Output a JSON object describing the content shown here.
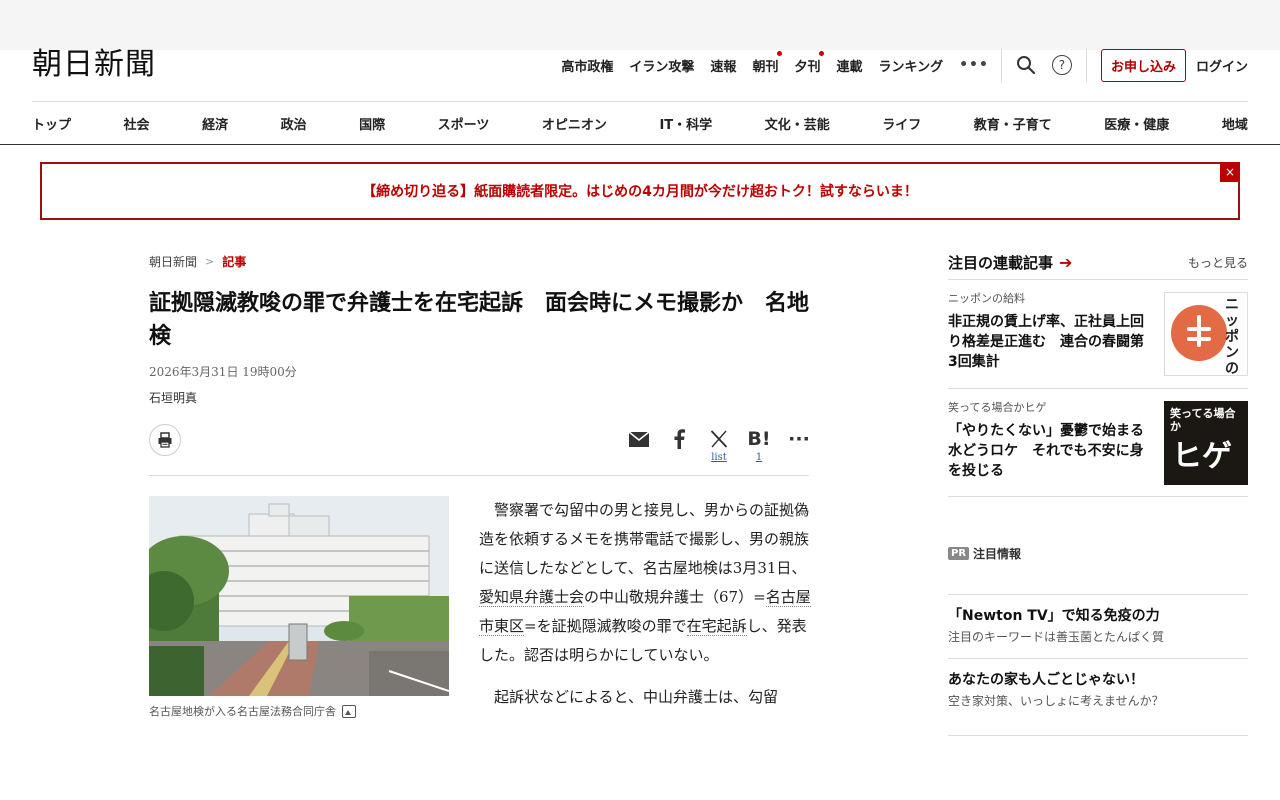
{
  "header": {
    "logo": "朝日新聞",
    "top_links": [
      {
        "label": "高市政権",
        "dot": false
      },
      {
        "label": "イラン攻撃",
        "dot": false
      },
      {
        "label": "速報",
        "dot": false
      },
      {
        "label": "朝刊",
        "dot": true
      },
      {
        "label": "夕刊",
        "dot": true
      },
      {
        "label": "連載",
        "dot": false
      },
      {
        "label": "ランキング",
        "dot": false
      }
    ],
    "more": "•••",
    "help": "?",
    "subscribe": "お申し込み",
    "login": "ログイン"
  },
  "nav": [
    "トップ",
    "社会",
    "経済",
    "政治",
    "国際",
    "スポーツ",
    "オピニオン",
    "IT・科学",
    "文化・芸能",
    "ライフ",
    "教育・子育て",
    "医療・健康",
    "地域"
  ],
  "banner": {
    "text": "【締め切り迫る】紙面購読者限定。はじめの4カ月間が今だけ超おトク！試すならいま！",
    "close": "×"
  },
  "article": {
    "breadcrumb_home": "朝日新聞",
    "breadcrumb_sep": ">",
    "breadcrumb_current": "記事",
    "title": "証拠隠滅教唆の罪で弁護士を在宅起訴　面会時にメモ撮影か　名地検",
    "date": "2026年3月31日 19時00分",
    "author": "石垣明真",
    "share": {
      "x_sub": "list",
      "hatena_label": "B!",
      "hatena_count": "1",
      "more": "···"
    },
    "photo_caption": "名古屋地検が入る名古屋法務合同庁舎",
    "p1_a": "警察署で勾留中の男と接見し、男からの証拠偽造を依頼するメモを携帯電話で撮影し、男の親族に送信したなどとして、名古屋地検は3月31日、",
    "p1_kw1": "愛知県弁護士会",
    "p1_b": "の中山敬規弁護士（67）=",
    "p1_kw2": "名古屋市東区",
    "p1_c": "=を証拠隠滅教唆の罪で",
    "p1_kw3": "在宅起訴",
    "p1_d": "し、発表した。認否は明らかにしていない。",
    "p2": "起訴状などによると、中山弁護士は、勾留"
  },
  "sidebar": {
    "title": "注目の連載記事",
    "more": "もっと見る",
    "series": [
      {
        "category": "ニッポンの給料",
        "title": "非正規の賃上げ率、正社員上回り格差是正進む　連合の春闘第3回集計",
        "thumb_text": "ニッポンの給料"
      },
      {
        "category": "笑ってる場合かヒゲ",
        "title": "「やりたくない」憂鬱で始まる水どうロケ　それでも不安に身を投じる",
        "thumb_text_small": "笑ってる場合か",
        "thumb_text_big": "ヒゲ"
      }
    ],
    "pr_badge": "PR",
    "pr_title": "注目情報",
    "pr_items": [
      {
        "title": "「Newton TV」で知る免疫の力",
        "sub": "注目のキーワードは善玉菌とたんぱく質"
      },
      {
        "title": "あなたの家も人ごとじゃない！",
        "sub": "空き家対策、いっしょに考えませんか？"
      }
    ]
  },
  "colors": {
    "brand_red": "#b00000",
    "banner_border": "#9a1010",
    "link_blue": "#2a5db0"
  }
}
